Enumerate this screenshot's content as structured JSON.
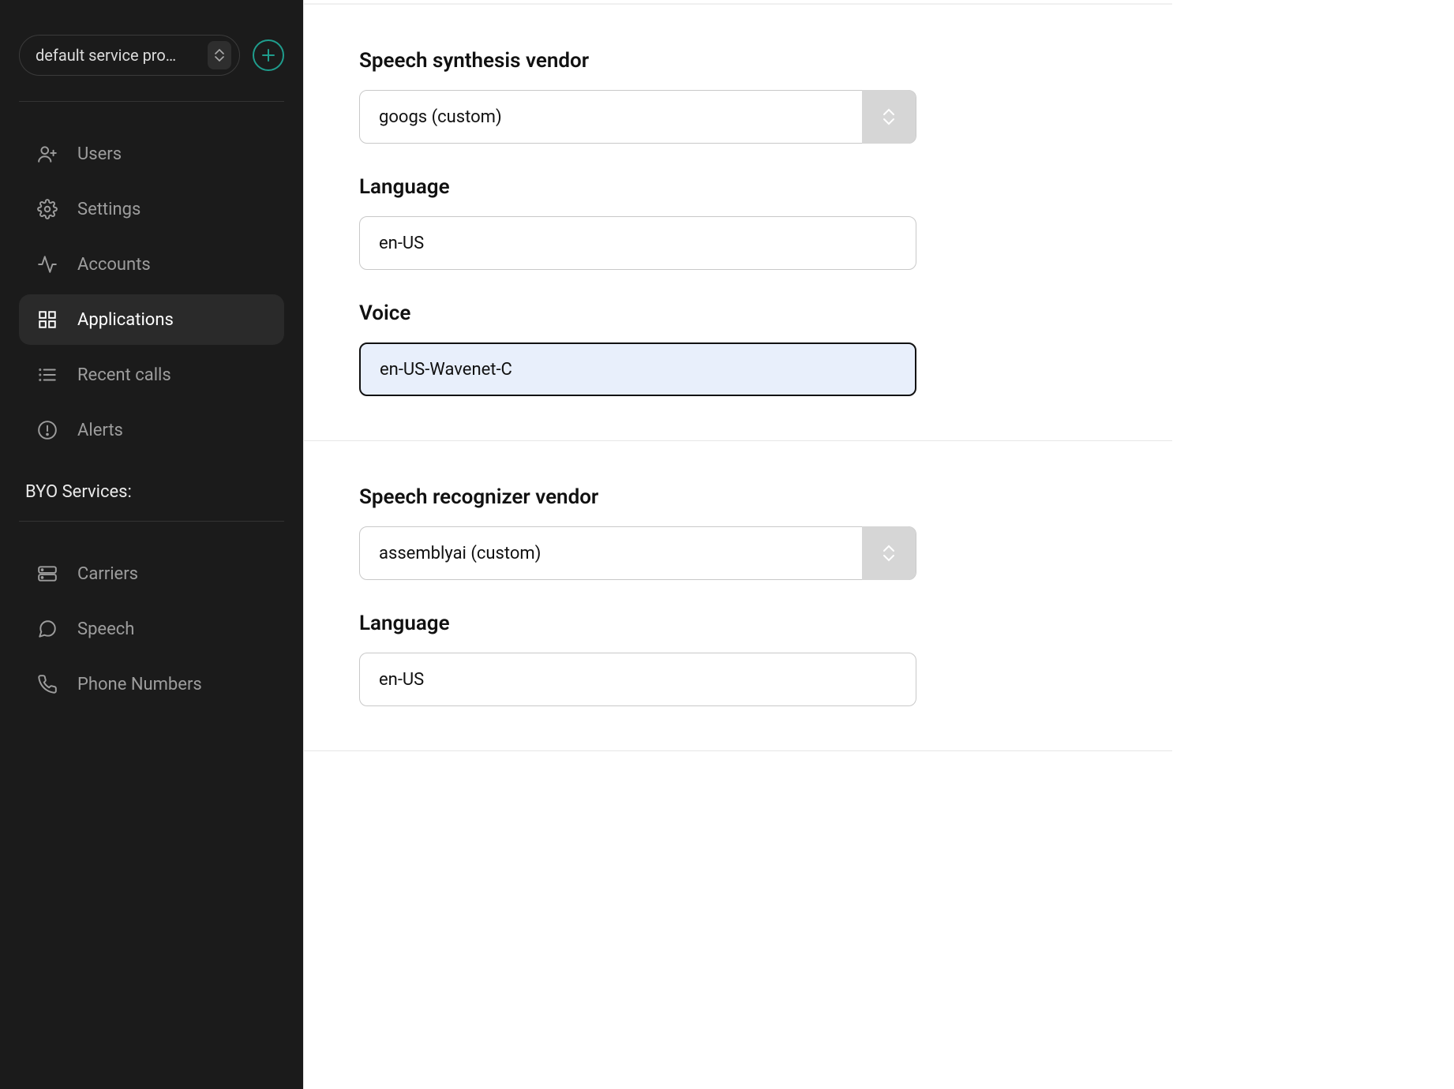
{
  "sidebar": {
    "service_provider": "default service pro…",
    "nav": [
      {
        "label": "Users",
        "icon": "user-add-icon"
      },
      {
        "label": "Settings",
        "icon": "gear-icon"
      },
      {
        "label": "Accounts",
        "icon": "activity-icon"
      },
      {
        "label": "Applications",
        "icon": "grid-icon"
      },
      {
        "label": "Recent calls",
        "icon": "list-icon"
      },
      {
        "label": "Alerts",
        "icon": "alert-icon"
      }
    ],
    "active_index": 3,
    "byo_section_label": "BYO Services:",
    "byo": [
      {
        "label": "Carriers",
        "icon": "server-icon"
      },
      {
        "label": "Speech",
        "icon": "speech-icon"
      },
      {
        "label": "Phone Numbers",
        "icon": "phone-icon"
      }
    ]
  },
  "main": {
    "sections": [
      {
        "fields": [
          {
            "label": "Speech synthesis vendor",
            "type": "select",
            "value": "googs (custom)"
          },
          {
            "label": "Language",
            "type": "text",
            "value": "en-US"
          },
          {
            "label": "Voice",
            "type": "text",
            "value": "en-US-Wavenet-C",
            "focused": true
          }
        ]
      },
      {
        "fields": [
          {
            "label": "Speech recognizer vendor",
            "type": "select",
            "value": "assemblyai (custom)"
          },
          {
            "label": "Language",
            "type": "text",
            "value": "en-US"
          }
        ]
      }
    ]
  }
}
